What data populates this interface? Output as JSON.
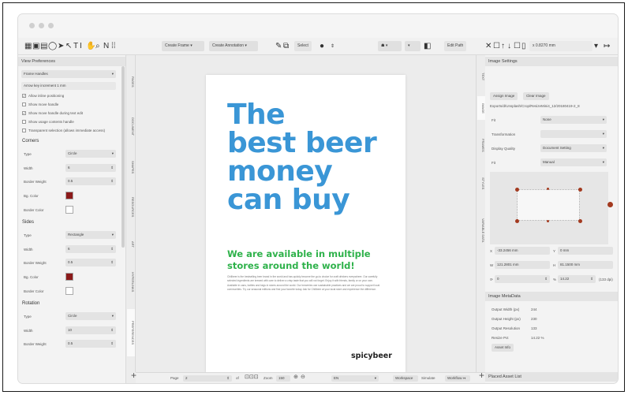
{
  "toolbar": {
    "create_frame": "Create Frame",
    "create_annotation": "Create Annotation",
    "select_label": "Select",
    "edit_path": "Edit Path",
    "measure_value": "0.8270 mm"
  },
  "left_panel": {
    "title": "View Preferences",
    "dropdown": "Frame Handles",
    "arrow_key_label": "Arrow key increment",
    "arrow_key_value": "1 mm",
    "checks": [
      {
        "label": "Allow inline positioning",
        "checked": true
      },
      {
        "label": "Show move handle",
        "checked": false
      },
      {
        "label": "Show move handle during text edit",
        "checked": true
      },
      {
        "label": "Show usage contents handle",
        "checked": false
      },
      {
        "label": "Transparent selection (allows immediate access)",
        "checked": false
      }
    ],
    "corners": {
      "title": "Corners",
      "type_label": "Type",
      "type_value": "Circle",
      "width_label": "Width",
      "width_value": "6",
      "border_label": "Border Weight",
      "border_value": "0.5",
      "bg_label": "Bg. Color",
      "bg_color": "#8b1a1a",
      "bordercolor_label": "Border Color"
    },
    "sides": {
      "title": "Sides",
      "type_label": "Type",
      "type_value": "Rectangle",
      "width_label": "Width",
      "width_value": "6",
      "border_label": "Border Weight",
      "border_value": "0.5",
      "bg_label": "Bg. Color",
      "bg_color": "#8b1a1a",
      "bordercolor_label": "Border Color"
    },
    "rotation": {
      "title": "Rotation",
      "type_label": "Type",
      "type_value": "Circle",
      "width_label": "Width",
      "width_value": "10",
      "border_label": "Border Weight",
      "border_value": "0.5"
    }
  },
  "left_tabs": [
    "PAGES",
    "DOCUMENT",
    "SHAPES",
    "RESOURCES",
    "ART",
    "HYPERLINKS",
    "PREFERENCES"
  ],
  "right_tabs": [
    "TEXT",
    "IMAGE",
    "FRAMES",
    "STYLES",
    "VARIABLE DATA"
  ],
  "page": {
    "headline": [
      "The",
      "best beer",
      "money",
      "can buy"
    ],
    "headline_color": "#3a96d6",
    "sub": [
      "We are available in multiple",
      "stores around the world!"
    ],
    "sub_color": "#2fb24b",
    "body": "Chillbeer is the bestselling beer brand in the world and has quickly become the go-to choice for craft drinkers everywhere. Our carefully selected ingredients are brewed with care to deliver a crisp taste that you will not forget. Enjoy it with friends, family or on your own. Available in cans, bottles and kegs in stores around the world. Our breweries use sustainable practices and we are proud to support local communities. Try our seasonal editions and find your favorite today. Ask for Chillbeer at your local store and experience the difference.",
    "brand_a": "spicy",
    "brand_b": "beer"
  },
  "right_panel": {
    "title": "Image Settings",
    "assign_image": "Assign Image",
    "clear_image": "Clear Image",
    "path": "Exports/d/Unsplash/Crop/ResizeMini4_12/20180419-2_8",
    "fit_label": "Fit",
    "fit_value": "None",
    "transform_label": "Transformation",
    "quality_label": "Display Quality",
    "quality_value": "Document Setting",
    "fill_label": "Fit",
    "fill_value": "Manual",
    "x_label": "X",
    "x_value": "-33.2456 mm",
    "y_label": "Y",
    "y_value": "0 mm",
    "w_label": "W",
    "w_value": "121.2801 mm",
    "h_label": "H",
    "h_value": "81.1500 mm",
    "r_value": "0",
    "scale_value": "14.22",
    "dpi_value": "(133 dpi)",
    "meta_title": "Image MetaData",
    "meta": [
      {
        "label": "Output Width (px)",
        "value": "244"
      },
      {
        "label": "Output Height (px)",
        "value": "230"
      },
      {
        "label": "Output Resolution",
        "value": "133"
      },
      {
        "label": "Resize Pct",
        "value": "14.22 %"
      }
    ],
    "asset_info": "Asset Info",
    "placed_title": "Placed Asset List"
  },
  "bottombar": {
    "page_label": "Page",
    "page_value": "2",
    "of_label": "of",
    "zoom_label": "Zoom",
    "zoom_value": "150",
    "unit_value": "EN",
    "workspace": "Workspace",
    "simulate": "Simulate",
    "workflow": "Workflow"
  }
}
